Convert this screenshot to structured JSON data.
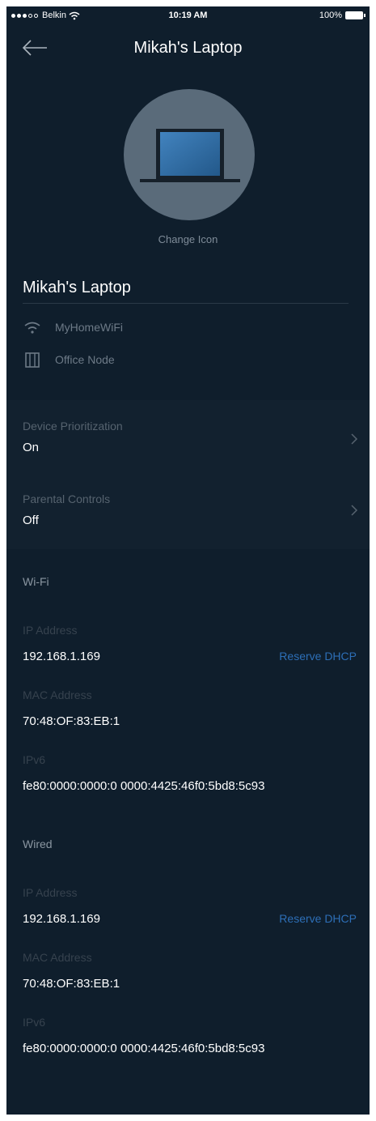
{
  "status_bar": {
    "carrier": "Belkin",
    "time": "10:19 AM",
    "battery": "100%"
  },
  "header": {
    "title": "Mikah's Laptop",
    "back_icon": "arrow-left-icon"
  },
  "device": {
    "icon": "laptop-icon",
    "change_icon_label": "Change Icon",
    "name": "Mikah's Laptop",
    "network": "MyHomeWiFi",
    "network_icon": "wifi-icon",
    "node": "Office Node",
    "node_icon": "node-icon"
  },
  "settings": {
    "prioritization": {
      "label": "Device Prioritization",
      "value": "On"
    },
    "parental": {
      "label": "Parental Controls",
      "value": "Off"
    }
  },
  "wifi": {
    "title": "Wi-Fi",
    "ip_label": "IP Address",
    "ip": "192.168.1.169",
    "reserve": "Reserve DHCP",
    "mac_label": "MAC Address",
    "mac": "70:48:OF:83:EB:1",
    "ipv6_label": "IPv6",
    "ipv6": "fe80:0000:0000:0 0000:4425:46f0:5bd8:5c93"
  },
  "wired": {
    "title": "Wired",
    "ip_label": "IP Address",
    "ip": "192.168.1.169",
    "reserve": "Reserve DHCP",
    "mac_label": "MAC Address",
    "mac": "70:48:OF:83:EB:1",
    "ipv6_label": "IPv6",
    "ipv6": "fe80:0000:0000:0 0000:4425:46f0:5bd8:5c93"
  },
  "colors": {
    "background": "#0f1e2c",
    "link": "#2d6fb7",
    "avatar": "#5a6b7a"
  }
}
